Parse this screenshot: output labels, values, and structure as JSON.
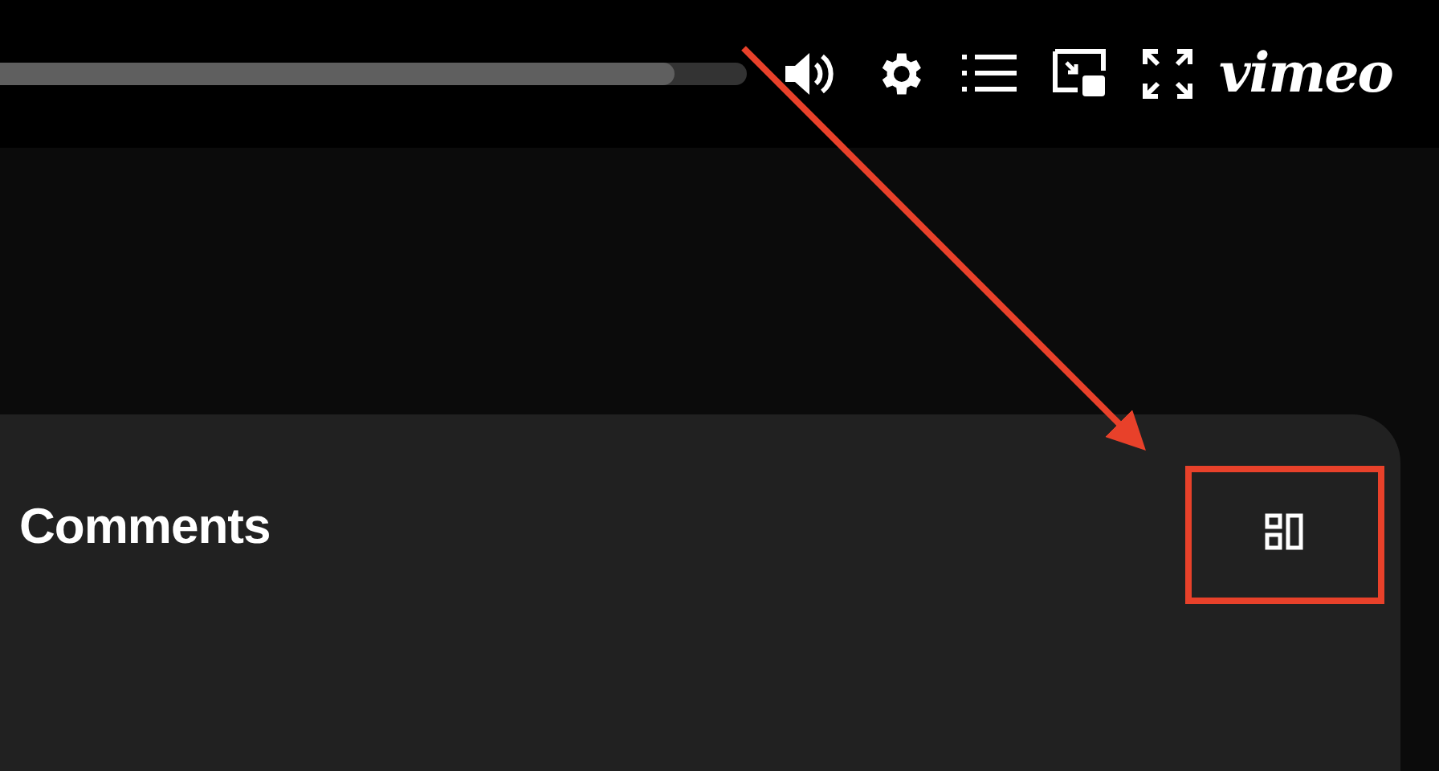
{
  "player": {
    "progress": {
      "level": 0.905
    },
    "logo": "vimeo"
  },
  "comments_panel": {
    "title": "Comments"
  }
}
